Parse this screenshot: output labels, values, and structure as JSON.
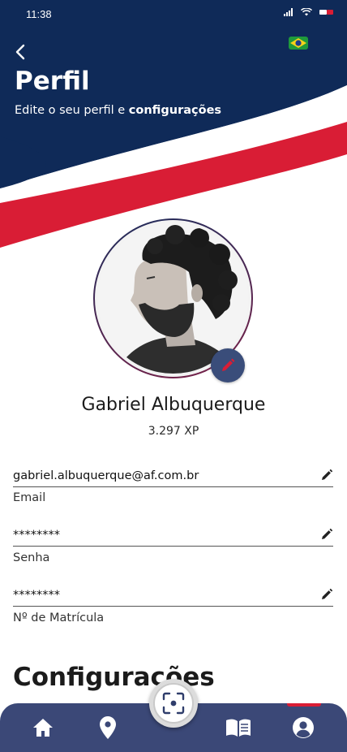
{
  "status_bar": {
    "time": "11:38"
  },
  "header": {
    "title": "Perfil",
    "subtitle_prefix": "Edite o seu perfil e ",
    "subtitle_bold": "configurações"
  },
  "profile": {
    "name": "Gabriel Albuquerque",
    "xp": "3.297 XP"
  },
  "fields": [
    {
      "value": "gabriel.albuquerque@af.com.br",
      "label": "Email"
    },
    {
      "value": "********",
      "label": "Senha"
    },
    {
      "value": "********",
      "label": "Nº de Matrícula"
    }
  ],
  "settings_section": {
    "title": "Configurações"
  },
  "bottom_nav": {
    "items": [
      "home-icon",
      "map-pin-icon",
      "qr-scan-icon",
      "book-icon",
      "user-icon"
    ],
    "active": "user-icon"
  },
  "colors": {
    "header_navy": "#0f2a58",
    "accent_red": "#d91d35",
    "nav_bg": "#3b4877"
  }
}
